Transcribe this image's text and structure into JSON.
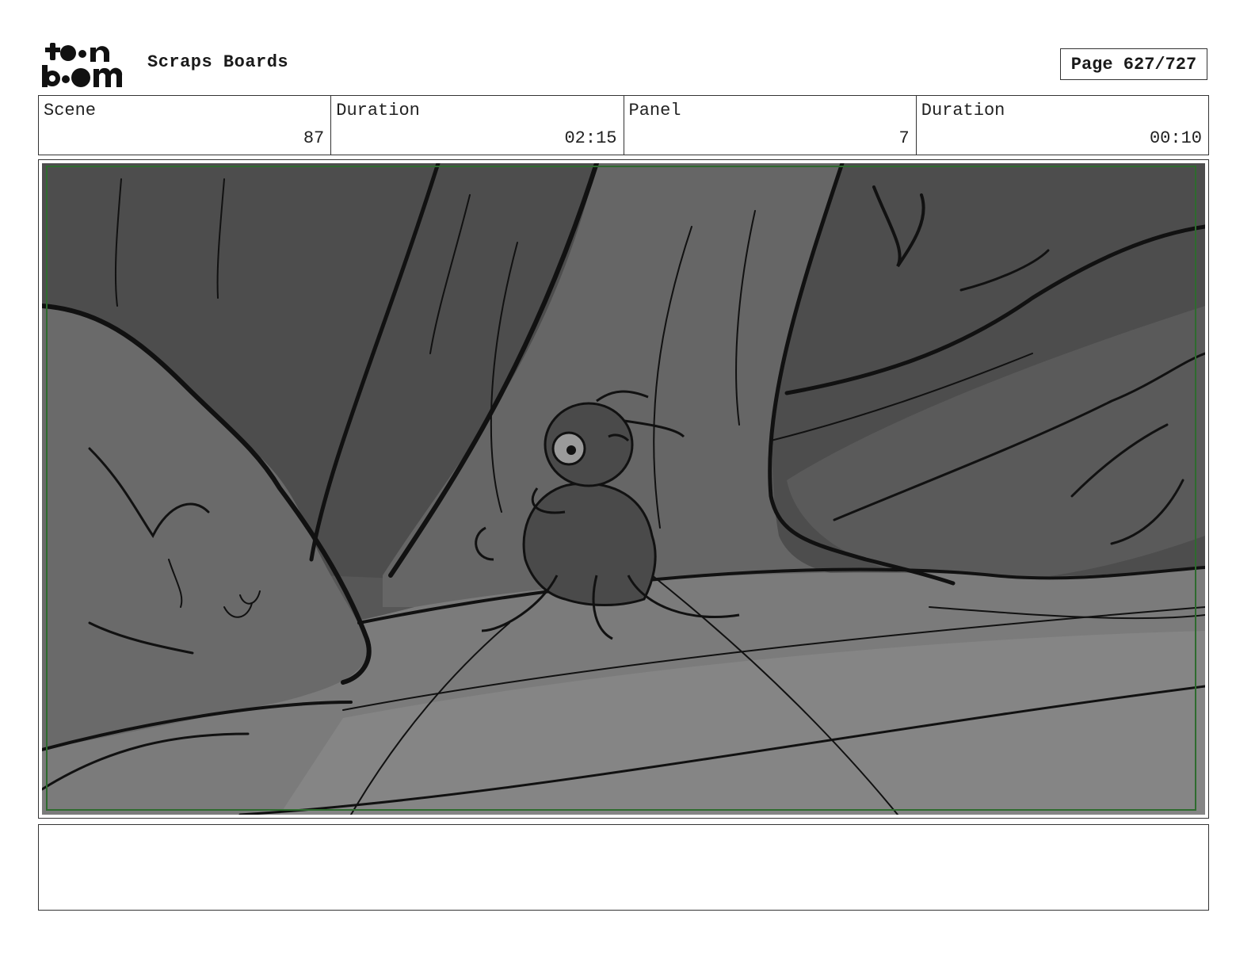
{
  "header": {
    "logo_text": "toon boom",
    "title": "Scraps Boards",
    "page_label": "Page 627/727"
  },
  "info": [
    {
      "label": "Scene",
      "value": "87"
    },
    {
      "label": "Duration",
      "value": "02:15"
    },
    {
      "label": "Panel",
      "value": "7"
    },
    {
      "label": "Duration",
      "value": "00:10"
    }
  ],
  "panel": {
    "frame_border_color": "#2e6b2e",
    "palette": [
      "#4a4a4a",
      "#5e5e5e",
      "#7a7a7a",
      "#8a8a8a",
      "#111111"
    ]
  },
  "notes": {
    "text": ""
  }
}
